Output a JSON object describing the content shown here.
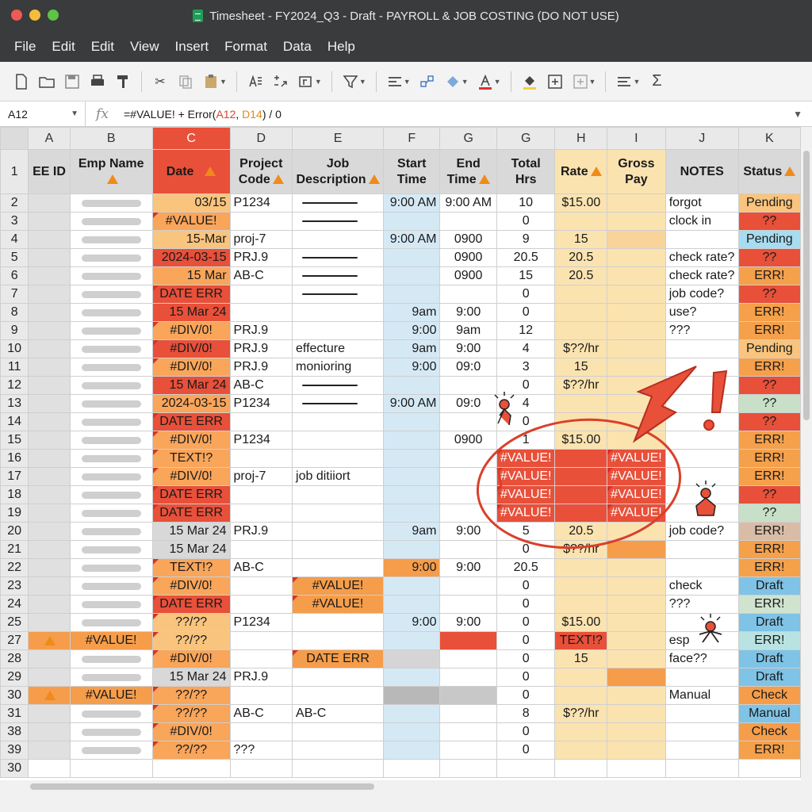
{
  "window": {
    "title": "Timesheet - FY2024_Q3 - Draft - PAYROLL & JOB COSTING (DO NOT USE)"
  },
  "menu": [
    "File",
    "Edit",
    "Edit",
    "View",
    "Insert",
    "Format",
    "Data",
    "Help"
  ],
  "formula_bar": {
    "cell": "A12",
    "fx": "fx",
    "prefix": "=#VALUE! + Error(",
    "ref1": "A12",
    "comma": ", ",
    "ref2": "D14",
    "suffix": ") / 0"
  },
  "columns": [
    "A",
    "B",
    "C",
    "D",
    "E",
    "F",
    "G",
    "G",
    "H",
    "I",
    "J",
    "K"
  ],
  "headers": {
    "row": "1",
    "ee_id": "EE ID",
    "emp_name": "Emp Name",
    "date": "Date",
    "project_code": "Project Code",
    "job_description": "Job Description",
    "start_time": "Start Time",
    "end_time": "End Time",
    "total_hrs": "Total Hrs",
    "rate": "Rate",
    "gross_pay": "Gross Pay",
    "notes": "NOTES",
    "status": "Status"
  },
  "rows": [
    {
      "n": "2",
      "date": "03/15",
      "proj": "P1234",
      "job": "",
      "start": "9:00 AM",
      "end": "9:00 AM",
      "hrs": "10",
      "rate": "$15.00",
      "gross": "",
      "notes": "forgot",
      "status": "Pending"
    },
    {
      "n": "3",
      "date": "#VALUE!",
      "proj": "",
      "job": "",
      "start": "",
      "end": "",
      "hrs": "0",
      "rate": "",
      "gross": "",
      "notes": "clock in",
      "status": "??"
    },
    {
      "n": "4",
      "date": "15-Mar",
      "proj": "proj-7",
      "job": "",
      "start": "9:00 AM",
      "end": "0900",
      "hrs": "9",
      "rate": "15",
      "gross": "",
      "notes": "",
      "status": "Pending"
    },
    {
      "n": "5",
      "date": "2024-03-15",
      "proj": "PRJ.9",
      "job": "",
      "start": "",
      "end": "0900",
      "hrs": "20.5",
      "rate": "20.5",
      "gross": "",
      "notes": "check rate?",
      "status": "??"
    },
    {
      "n": "6",
      "date": "15 Mar",
      "proj": "AB-C",
      "job": "",
      "start": "",
      "end": "0900",
      "hrs": "15",
      "rate": "20.5",
      "gross": "",
      "notes": "check rate?",
      "status": "ERR!"
    },
    {
      "n": "7",
      "date": "DATE ERR",
      "proj": "",
      "job": "",
      "start": "",
      "end": "",
      "hrs": "0",
      "rate": "",
      "gross": "",
      "notes": "job code?",
      "status": "??"
    },
    {
      "n": "8",
      "date": "15 Mar 24",
      "proj": "",
      "job": "",
      "start": "9am",
      "end": "9:00",
      "hrs": "0",
      "rate": "",
      "gross": "",
      "notes": "use?",
      "status": "ERR!"
    },
    {
      "n": "9",
      "date": "#DIV/0!",
      "proj": "PRJ.9",
      "job": "",
      "start": "9:00",
      "end": "9am",
      "hrs": "12",
      "rate": "",
      "gross": "",
      "notes": "???",
      "status": "ERR!"
    },
    {
      "n": "10",
      "date": "#DIV/0!",
      "proj": "PRJ.9",
      "job": "effecture",
      "start": "9am",
      "end": "9:00",
      "hrs": "4",
      "rate": "$??/hr",
      "gross": "",
      "notes": "",
      "status": "Pending"
    },
    {
      "n": "11",
      "date": "#DIV/0!",
      "proj": "PRJ.9",
      "job": "monioring",
      "start": "9:00",
      "end": "09:0",
      "hrs": "3",
      "rate": "15",
      "gross": "",
      "notes": "",
      "status": "ERR!"
    },
    {
      "n": "12",
      "date": "15 Mar 24",
      "proj": "AB-C",
      "job": "",
      "start": "",
      "end": "",
      "hrs": "0",
      "rate": "$??/hr",
      "gross": "",
      "notes": "",
      "status": "??"
    },
    {
      "n": "13",
      "date": "2024-03-15",
      "proj": "P1234",
      "job": "",
      "start": "9:00 AM",
      "end": "09:0",
      "hrs": "4",
      "rate": "",
      "gross": "",
      "notes": "",
      "status": "??"
    },
    {
      "n": "14",
      "date": "DATE ERR",
      "proj": "",
      "job": "",
      "start": "",
      "end": "",
      "hrs": "0",
      "rate": "",
      "gross": "",
      "notes": "",
      "status": "??"
    },
    {
      "n": "15",
      "date": "#DIV/0!",
      "proj": "P1234",
      "job": "",
      "start": "",
      "end": "0900",
      "hrs": "1",
      "rate": "$15.00",
      "gross": "",
      "notes": "",
      "status": "ERR!"
    },
    {
      "n": "16",
      "date": "TEXT!?",
      "proj": "",
      "job": "",
      "start": "",
      "end": "",
      "hrs": "#VALUE!",
      "rate": "",
      "gross": "#VALUE!",
      "notes": "",
      "status": "ERR!"
    },
    {
      "n": "17",
      "date": "#DIV/0!",
      "proj": "proj-7",
      "job": "job ditiiort",
      "start": "",
      "end": "",
      "hrs": "#VALUE!",
      "rate": "",
      "gross": "#VALUE!",
      "notes": "",
      "status": "ERR!"
    },
    {
      "n": "18",
      "date": "DATE ERR",
      "proj": "",
      "job": "",
      "start": "",
      "end": "",
      "hrs": "#VALUE!",
      "rate": "",
      "gross": "#VALUE!",
      "notes": "",
      "status": "??"
    },
    {
      "n": "19",
      "date": "DATE ERR",
      "proj": "",
      "job": "",
      "start": "",
      "end": "",
      "hrs": "#VALUE!",
      "rate": "",
      "gross": "#VALUE!",
      "notes": "",
      "status": "??"
    },
    {
      "n": "20",
      "date": "15 Mar 24",
      "proj": "PRJ.9",
      "job": "",
      "start": "9am",
      "end": "9:00",
      "hrs": "5",
      "rate": "20.5",
      "gross": "",
      "notes": "job code?",
      "status": "ERR!"
    },
    {
      "n": "21",
      "date": "15 Mar 24",
      "proj": "",
      "job": "",
      "start": "",
      "end": "",
      "hrs": "0",
      "rate": "$??/hr",
      "gross": "",
      "notes": "",
      "status": "ERR!"
    },
    {
      "n": "22",
      "date": "TEXT!?",
      "proj": "AB-C",
      "job": "",
      "start": "9:00",
      "end": "9:00",
      "hrs": "20.5",
      "rate": "",
      "gross": "",
      "notes": "",
      "status": "ERR!"
    },
    {
      "n": "23",
      "date": "#DIV/0!",
      "proj": "",
      "job": "#VALUE!",
      "start": "",
      "end": "",
      "hrs": "0",
      "rate": "",
      "gross": "",
      "notes": "check",
      "status": "Draft"
    },
    {
      "n": "24",
      "date": "DATE ERR",
      "proj": "",
      "job": "#VALUE!",
      "start": "",
      "end": "",
      "hrs": "0",
      "rate": "",
      "gross": "",
      "notes": "???",
      "status": "ERR!"
    },
    {
      "n": "25",
      "date": "??/??",
      "proj": "P1234",
      "job": "",
      "start": "9:00",
      "end": "9:00",
      "hrs": "0",
      "rate": "$15.00",
      "gross": "",
      "notes": "",
      "status": "Draft"
    },
    {
      "n": "27",
      "ee": "#VALUE!",
      "date": "??/??",
      "proj": "",
      "job": "",
      "start": "",
      "end": "",
      "hrs": "0",
      "rate": "TEXT!?",
      "gross": "",
      "notes": "esp",
      "status": "ERR!"
    },
    {
      "n": "28",
      "date": "#DIV/0!",
      "proj": "",
      "job": "DATE ERR",
      "start": "",
      "end": "",
      "hrs": "0",
      "rate": "15",
      "gross": "",
      "notes": "face??",
      "status": "Draft"
    },
    {
      "n": "29",
      "date": "15 Mar 24",
      "proj": "PRJ.9",
      "job": "",
      "start": "",
      "end": "",
      "hrs": "0",
      "rate": "",
      "gross": "",
      "notes": "",
      "status": "Draft"
    },
    {
      "n": "30",
      "ee": "#VALUE!",
      "date": "??/??",
      "proj": "",
      "job": "",
      "start": "",
      "end": "",
      "hrs": "0",
      "rate": "",
      "gross": "",
      "notes": "Manual",
      "status": "Check"
    },
    {
      "n": "31",
      "date": "??/??",
      "proj": "AB-C",
      "job": "AB-C",
      "start": "",
      "end": "",
      "hrs": "8",
      "rate": "$??/hr",
      "gross": "",
      "notes": "",
      "status": "Manual"
    },
    {
      "n": "38",
      "date": "#DIV/0!",
      "proj": "",
      "job": "",
      "start": "",
      "end": "",
      "hrs": "0",
      "rate": "",
      "gross": "",
      "notes": "",
      "status": "Check"
    },
    {
      "n": "39",
      "date": "??/??",
      "proj": "???",
      "job": "",
      "start": "",
      "end": "",
      "hrs": "0",
      "rate": "",
      "gross": "",
      "notes": "",
      "status": "ERR!"
    },
    {
      "n": "30",
      "date": "",
      "proj": "",
      "job": "",
      "start": "",
      "end": "",
      "hrs": "",
      "rate": "",
      "gross": "",
      "notes": "",
      "status": ""
    }
  ],
  "colors": {
    "error_red": "#e8503a",
    "orange": "#f59d4a",
    "light_orange": "#f9c47d",
    "blue_tint": "#d5e9f5",
    "yellow_tint": "#fbe3b0",
    "warning": "#f08a1a",
    "annotation": "#d9402b"
  },
  "icons": [
    "new-file-icon",
    "open-folder-icon",
    "save-icon",
    "print-icon",
    "format-painter-icon",
    "cut-icon",
    "copy-icon",
    "paste-icon",
    "sort-icon",
    "number-format-icon",
    "function-icon",
    "filter-icon",
    "align-icon",
    "merge-icon",
    "fill-icon",
    "font-color-icon",
    "fill-color-icon",
    "insert-comment-icon",
    "insert-cell-icon",
    "text-align-icon",
    "sum-icon"
  ]
}
